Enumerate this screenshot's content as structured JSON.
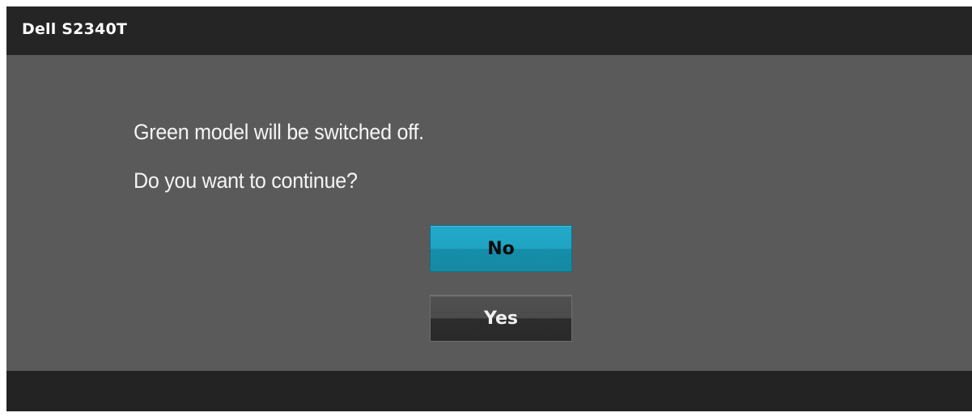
{
  "window": {
    "title": "Dell S2340T"
  },
  "dialog": {
    "message_line1": "Green model will be switched off.",
    "message_line2": "Do you want to continue?",
    "buttons": {
      "no_label": "No",
      "yes_label": "Yes"
    },
    "selected_button": "No"
  },
  "colors": {
    "title_bar": "#252525",
    "content_background": "#5a5a5a",
    "selected_button": "#20a4c3",
    "unselected_button": "#3a3a3a"
  }
}
